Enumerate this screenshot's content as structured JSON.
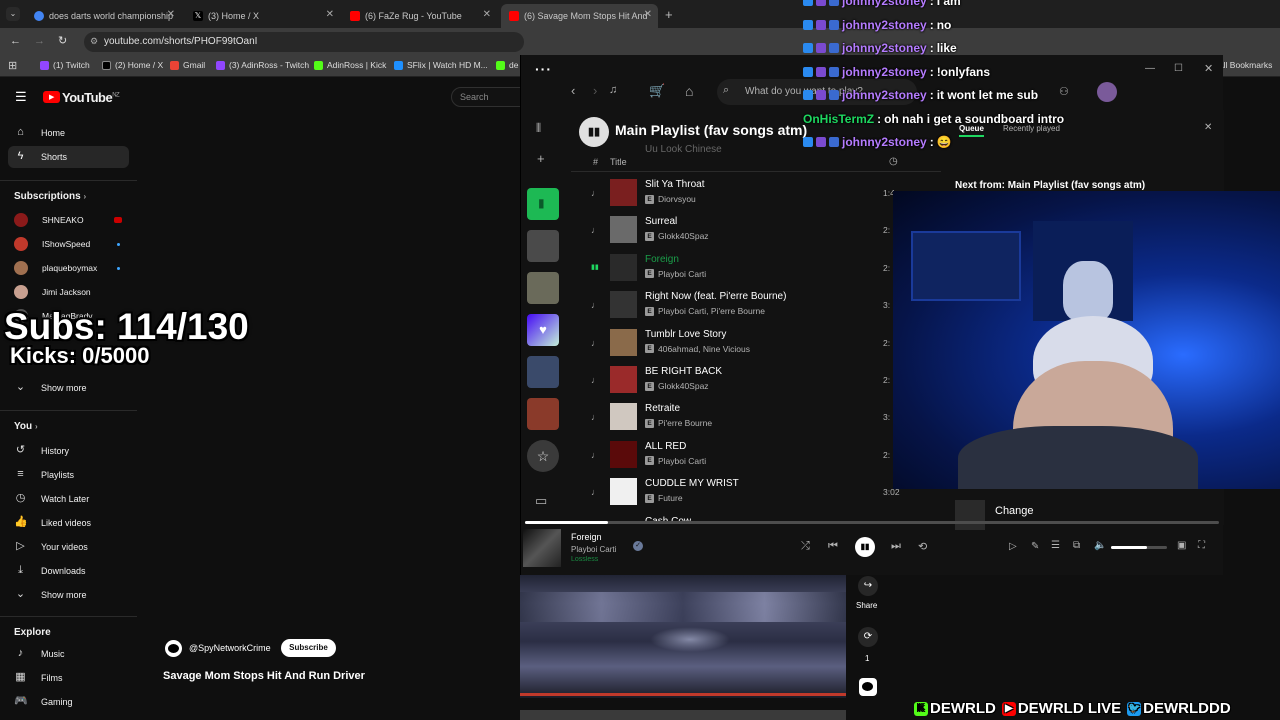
{
  "browser": {
    "tabs": [
      {
        "title": "does darts world championship",
        "active": false
      },
      {
        "title": "(3) Home / X",
        "active": false
      },
      {
        "title": "(6) FaZe Rug - YouTube",
        "active": false
      },
      {
        "title": "(6) Savage Mom Stops Hit And",
        "active": true
      }
    ],
    "url": "youtube.com/shorts/PHOF99tOanI",
    "bookmarks": [
      "(1) Twitch",
      "(2) Home / X",
      "Gmail",
      "(3) AdinRoss - Twitch",
      "AdinRoss | Kick",
      "SFlix | Watch HD M...",
      "de"
    ],
    "all_bookmarks": "All Bookmarks"
  },
  "youtube": {
    "logo": "YouTube",
    "logo_region": "NZ",
    "search_placeholder": "Search",
    "nav": [
      {
        "label": "Home",
        "icon": "home-icon"
      },
      {
        "label": "Shorts",
        "icon": "shorts-icon"
      }
    ],
    "subscriptions_label": "Subscriptions",
    "subscriptions": [
      "SHNEAKO",
      "IShowSpeed",
      "plaqueboymax",
      "Jimi Jackson",
      "MarkaqBrady"
    ],
    "show_more": "Show more",
    "you_label": "You",
    "you_items": [
      {
        "label": "History",
        "icon": "history-icon"
      },
      {
        "label": "Playlists",
        "icon": "playlists-icon"
      },
      {
        "label": "Watch Later",
        "icon": "clock-icon"
      },
      {
        "label": "Liked videos",
        "icon": "thumbs-up-icon"
      },
      {
        "label": "Your videos",
        "icon": "play-icon"
      },
      {
        "label": "Downloads",
        "icon": "download-icon"
      }
    ],
    "show_more_2": "Show more",
    "explore_label": "Explore",
    "explore_items": [
      {
        "label": "Music",
        "icon": "music-icon"
      },
      {
        "label": "Films",
        "icon": "film-icon"
      },
      {
        "label": "Gaming",
        "icon": "gaming-icon"
      }
    ],
    "short": {
      "channel": "@SpyNetworkCrime",
      "subscribe": "Subscribe",
      "title": "Savage Mom Stops Hit And Run Driver",
      "share": "Share",
      "remix_count": "1"
    }
  },
  "spotify": {
    "search_placeholder": "What do you want to play?",
    "playlist_title": "Main Playlist (fav songs atm)",
    "header_hash": "#",
    "header_title": "Title",
    "prev_track_partial": "Uu Look Chinese",
    "tracks": [
      {
        "n": "♩",
        "title": "Slit Ya Throat",
        "artist": "Diorvsyou",
        "dur": "1:4",
        "color": "#7a1f1f"
      },
      {
        "n": "♩",
        "title": "Surreal",
        "artist": "Glokk40Spaz",
        "dur": "2:",
        "color": "#6a6a6a"
      },
      {
        "n": "▮▮",
        "title": "Foreign",
        "artist": "Playboi Carti",
        "dur": "2:",
        "color": "#2a2a2a",
        "playing": true
      },
      {
        "n": "♩",
        "title": "Right Now (feat. Pi'erre Bourne)",
        "artist": "Playboi Carti, Pi'erre Bourne",
        "dur": "3:",
        "color": "#333333"
      },
      {
        "n": "♩",
        "title": "Tumblr Love Story",
        "artist": "406ahmad, Nine Vicious",
        "dur": "2:",
        "color": "#8a6a4a"
      },
      {
        "n": "♩",
        "title": "BE RIGHT BACK",
        "artist": "Glokk40Spaz",
        "dur": "2:",
        "color": "#9a2a2a"
      },
      {
        "n": "♩",
        "title": "Retraite",
        "artist": "Pi'erre Bourne",
        "dur": "3:",
        "color": "#d0c8c0"
      },
      {
        "n": "♩",
        "title": "ALL RED",
        "artist": "Playboi Carti",
        "dur": "2:",
        "color": "#5a0a0a"
      },
      {
        "n": "♩",
        "title": "CUDDLE MY WRIST",
        "artist": "Future",
        "dur": "3:02",
        "color": "#f0f0f0"
      }
    ],
    "next_track_partial": "Cash Cow",
    "queue_tab": "Queue",
    "recent_tab": "Recently played",
    "next_from": "Next from: Main Playlist (fav songs atm)",
    "queue_item": "Change",
    "now_playing": {
      "title": "Foreign",
      "artist": "Playboi Carti",
      "quality": "Lossless"
    },
    "progress": 0.12,
    "volume": 0.65
  },
  "chat": [
    {
      "user": "johnny2stoney",
      "msg": "I am",
      "badges": true
    },
    {
      "user": "johnny2stoney",
      "msg": "no",
      "badges": true
    },
    {
      "user": "johnny2stoney",
      "msg": "like",
      "badges": true
    },
    {
      "user": "johnny2stoney",
      "msg": "!onlyfans",
      "badges": true
    },
    {
      "user": "johnny2stoney",
      "msg": "it wont let me sub",
      "badges": true
    },
    {
      "user": "OnHisTermZ",
      "msg": "oh nah i get a soundboard intro",
      "badges": false
    },
    {
      "user": "johnny2stoney",
      "msg": "😄",
      "badges": true
    }
  ],
  "overlay": {
    "subs": "Subs: 114/130",
    "kicks": "Kicks: 0/5000",
    "socials": [
      "DEWRLD",
      "DEWRLD LIVE",
      "DEWRLDDD"
    ]
  },
  "colors": {
    "spotify_green": "#1ed760",
    "youtube_red": "#ff0000",
    "twitch_purple": "#9146ff"
  }
}
